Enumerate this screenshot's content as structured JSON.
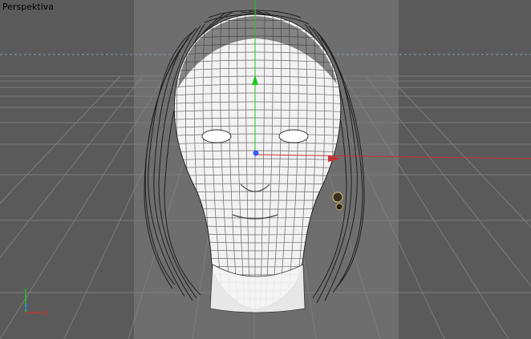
{
  "viewport": {
    "label": "Perspektiva",
    "colors": {
      "background": "#6a6a6a",
      "safe_frame_side": "#555555",
      "grid_line": "#7e7e7e",
      "wire": "#ffffff",
      "hair": "#1a1a1a",
      "axis_x": "#c83232",
      "axis_y": "#1fc81f",
      "axis_z": "#3b5bff"
    }
  },
  "object": {
    "name": "head-wireframe-model"
  },
  "gizmo": {
    "x_label": "X",
    "y_label": "Y",
    "z_label": "Z"
  }
}
